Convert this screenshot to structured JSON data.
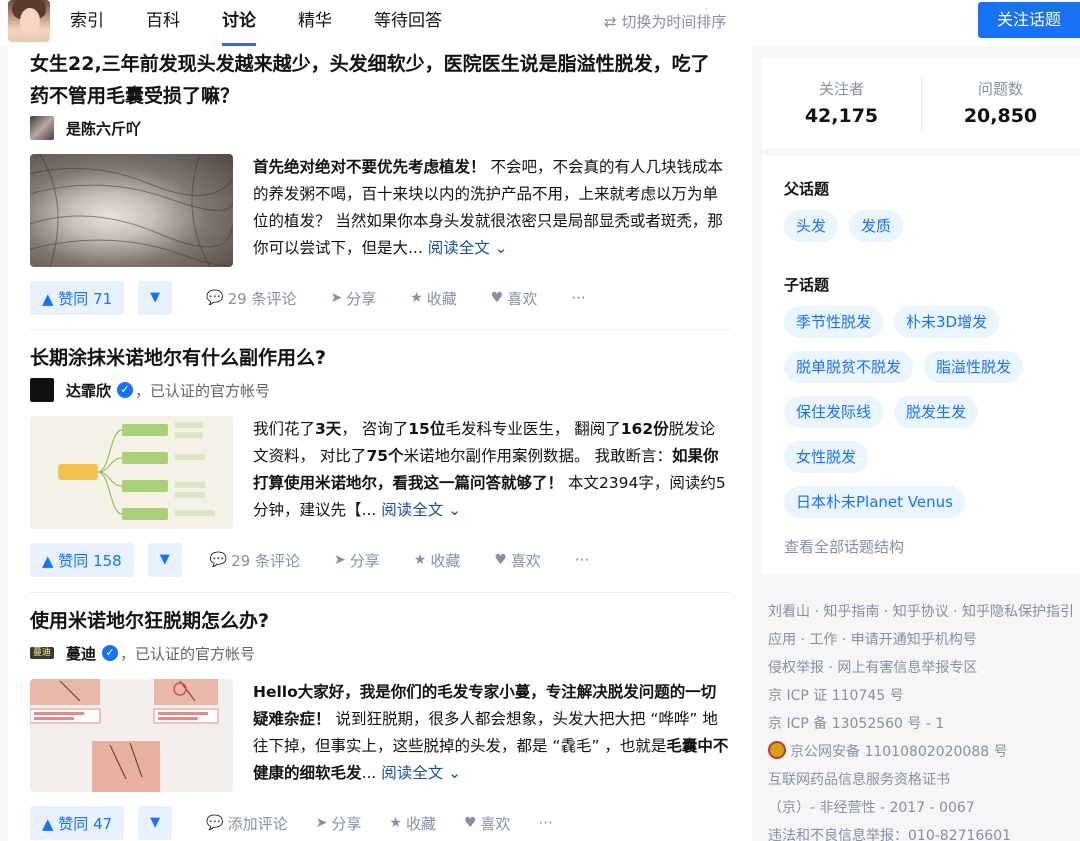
{
  "header": {
    "tabs": [
      "索引",
      "百科",
      "讨论",
      "精华",
      "等待回答"
    ],
    "active_tab": "讨论",
    "sort_toggle": "切换为时间排序",
    "follow_button": "关注话题"
  },
  "items": [
    {
      "title_line1": "女生22,三年前发现头发越来越少，头发细软少，医院医生说是脂溢性脱发，吃了",
      "title_line2": "药不管用毛囊受损了嘛？",
      "author": "是陈六斤吖",
      "excerpt_bold": "首先绝对绝对不要优先考虑植发！",
      "excerpt": " 不会吧，不会真的有人几块钱成本的养发粥不喝，百十来块以内的洗护产品不用，上来就考虑以万为单位的植发？ 当然如果你本身头发就很浓密只是局部显秃或者斑秃，那你可以尝试下，但是大... ",
      "read_more": "阅读全文 ⌄",
      "vote": "▲ 赞同 71",
      "comments": "29 条评论",
      "share": "分享",
      "collect": "收藏",
      "like": "喜欢",
      "more": "···"
    },
    {
      "title_line1": "长期涂抹米诺地尔有什么副作用么?",
      "author": "达霏欣",
      "author_tag": "，已认证的官方帐号",
      "excerpt_html_parts": [
        "我们花了",
        "3天",
        "， 咨询了",
        "15位",
        "毛发科专业医生， 翻阅了",
        "162份",
        "脱发论文资料， 对比了",
        "75个",
        "米诺地尔副作用案例数据。 我敢断言：",
        "如果你打算使用米诺地尔，看我这一篇问答就够了！",
        " 本文2394字，阅读约5分钟，建议先【... "
      ],
      "read_more": "阅读全文 ⌄",
      "vote": "▲ 赞同 158",
      "comments": "29 条评论",
      "share": "分享",
      "collect": "收藏",
      "like": "喜欢",
      "more": "···"
    },
    {
      "title_line1": "使用米诺地尔狂脱期怎么办?",
      "author": "蔓迪",
      "author_tag": "，已认证的官方帐号",
      "avatar_text": "蔓迪",
      "excerpt_bold": "Hello大家好，我是你们的毛发专家小蔓，专注解决脱发问题的一切疑难杂症！",
      "excerpt": " 说到狂脱期，很多人都会想象，头发大把大把 “哗哗” 地往下掉，但事实上，这些脱掉的头发，都是 “毳毛” ，也就是",
      "excerpt_bold2": "毛囊中不健康的细软毛发",
      "excerpt_tail": "... ",
      "read_more": "阅读全文 ⌄",
      "vote": "▲ 赞同 47",
      "comments": "添加评论",
      "share": "分享",
      "collect": "收藏",
      "like": "喜欢",
      "more": "···"
    }
  ],
  "sidebar": {
    "followers_label": "关注者",
    "followers": "42,175",
    "questions_label": "问题数",
    "questions": "20,850",
    "parent_title": "父话题",
    "parent_topics": [
      "头发",
      "发质"
    ],
    "child_title": "子话题",
    "child_topics": [
      "季节性脱发",
      "朴未3D增发",
      "脱单脱贫不脱发",
      "脂溢性脱发",
      "保住发际线",
      "脱发生发",
      "女性脱发",
      "日本朴未Planet Venus"
    ],
    "view_all": "查看全部话题结构"
  },
  "footer": {
    "line1": "刘看山 · 知乎指南 · 知乎协议 · 知乎隐私保护指引",
    "line2": "应用 · 工作 · 申请开通知乎机构号",
    "line3": "侵权举报 · 网上有害信息举报专区",
    "line4": "京 ICP 证 110745 号",
    "line5": "京 ICP 备 13052560 号 - 1",
    "line6": "京公网安备 11010802020088 号",
    "line7": "互联网药品信息服务资格证书",
    "line8": "（京）- 非经营性 - 2017 - 0067",
    "line9": "违法和不良信息举报：010-82716601"
  },
  "colors": {
    "accent": "#1772f6",
    "chip_bg": "#ebf5ff",
    "muted": "#8590a6"
  }
}
